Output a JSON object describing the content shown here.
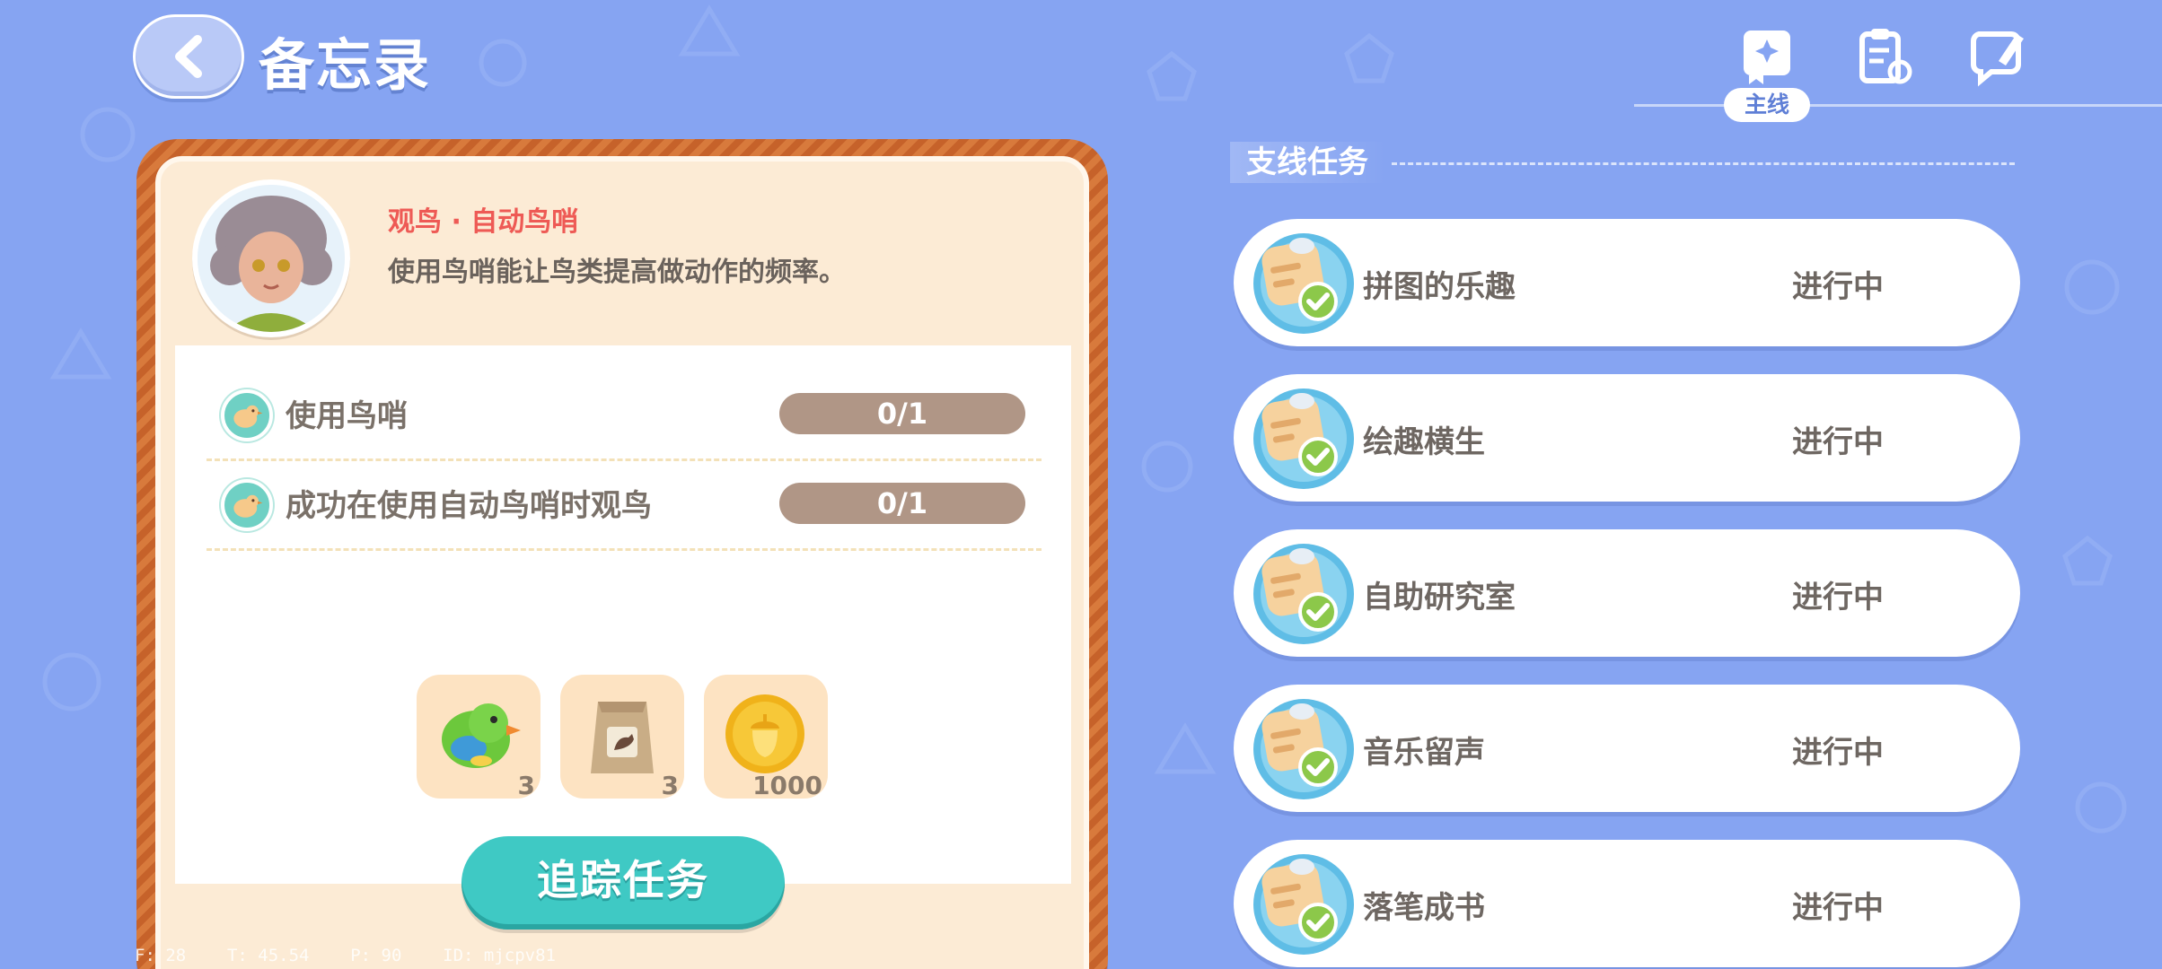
{
  "header": {
    "title": "备忘录",
    "tabs": [
      {
        "label": "主线",
        "icon": "main-quest-book-icon",
        "selected": true
      },
      {
        "label": "",
        "icon": "clipboard-refresh-icon",
        "selected": false
      },
      {
        "label": "",
        "icon": "feedback-pen-icon",
        "selected": false
      }
    ]
  },
  "task": {
    "title": "观鸟 · 自动鸟哨",
    "description": "使用鸟哨能让鸟类提高做动作的频率。",
    "objectives": [
      {
        "label": "使用鸟哨",
        "progress": "0/1",
        "icon": "bird-icon"
      },
      {
        "label": "成功在使用自动鸟哨时观鸟",
        "progress": "0/1",
        "icon": "bird-icon"
      }
    ],
    "rewards": [
      {
        "icon": "green-bird-icon",
        "count": "3"
      },
      {
        "icon": "bird-seed-bag-icon",
        "count": "3"
      },
      {
        "icon": "acorn-coin-icon",
        "count": "1000"
      }
    ],
    "track_button": "追踪任务"
  },
  "side_quests": {
    "title": "支线任务",
    "items": [
      {
        "name": "拼图的乐趣",
        "status": "进行中"
      },
      {
        "name": "绘趣横生",
        "status": "进行中"
      },
      {
        "name": "自助研究室",
        "status": "进行中"
      },
      {
        "name": "音乐留声",
        "status": "进行中"
      },
      {
        "name": "落笔成书",
        "status": "进行中"
      }
    ]
  },
  "debug": {
    "text": "F: 28    T: 45.54    P: 90    ID: mjcpv81"
  },
  "colors": {
    "background": "#86a4f2",
    "accent_teal": "#3fc9c4",
    "task_title_red": "#ee5a55",
    "progress_bar": "#b09686",
    "card_frame": "#d87a3c"
  }
}
